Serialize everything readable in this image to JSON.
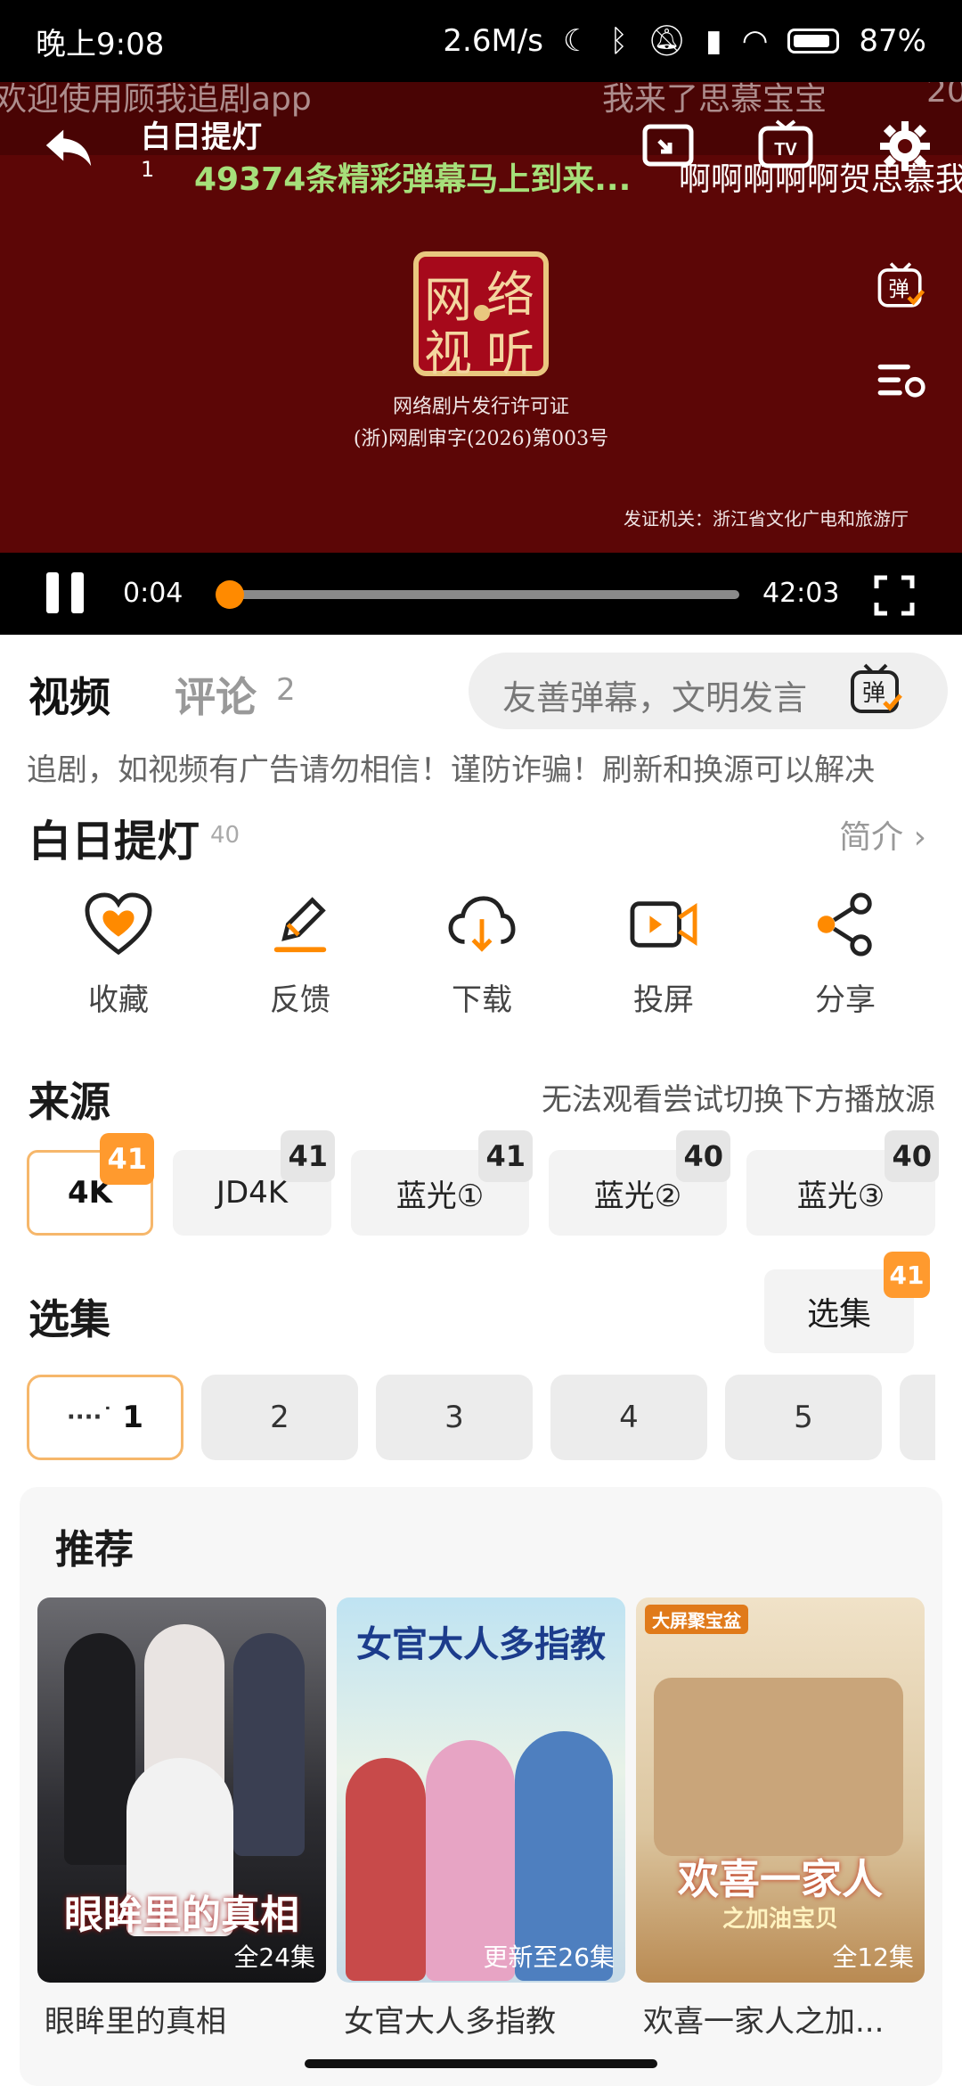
{
  "status_bar": {
    "time": "晚上9:08",
    "speed": "2.6M/s",
    "battery": "87%"
  },
  "player": {
    "title": "白日提灯",
    "episode": "1",
    "danmu": [
      "欢迎使用顾我追剧app",
      "我来了思慕宝宝",
      "20",
      "49374条精彩弹幕马上到来...",
      "啊啊啊啊啊贺思慕我"
    ],
    "seal_chars": [
      "网",
      "络",
      "视",
      "听"
    ],
    "license_line1": "网络剧片发行许可证",
    "license_line2": "(浙)网剧审字(2026)第003号",
    "issuer": "发证机关：浙江省文化广电和旅游厅",
    "time_current": "0:04",
    "time_total": "42:03",
    "progress_fraction": 0.02,
    "tv_label": "TV",
    "danmu_toggle_label": "弹"
  },
  "tabs": {
    "video_label": "视频",
    "comment_label": "评论",
    "comment_count": "2",
    "danmu_placeholder": "友善弹幕，文明发言",
    "danmu_btn_label": "弹"
  },
  "notice": "追剧，如视频有广告请勿相信！谨防诈骗！刷新和换源可以解决",
  "show": {
    "title": "白日提灯",
    "count": "40",
    "intro_label": "简介 ›"
  },
  "actions": [
    {
      "label": "收藏",
      "icon": "heart-icon"
    },
    {
      "label": "反馈",
      "icon": "edit-icon"
    },
    {
      "label": "下载",
      "icon": "cloud-download-icon"
    },
    {
      "label": "投屏",
      "icon": "cast-icon"
    },
    {
      "label": "分享",
      "icon": "share-icon"
    }
  ],
  "source": {
    "title": "来源",
    "hint": "无法观看尝试切换下方播放源",
    "items": [
      {
        "label": "4K",
        "count": "41"
      },
      {
        "label": "JD4K",
        "count": "41"
      },
      {
        "label": "蓝光①",
        "count": "41"
      },
      {
        "label": "蓝光②",
        "count": "40"
      },
      {
        "label": "蓝光③",
        "count": "40"
      }
    ]
  },
  "episodes": {
    "title": "选集",
    "select_label": "选集",
    "select_count": "41",
    "items": [
      "1",
      "2",
      "3",
      "4",
      "5"
    ]
  },
  "recommend": {
    "title": "推荐",
    "items": [
      {
        "name": "眼眸里的真相",
        "badge": "全24集",
        "poster_text": "眼眸里的真相"
      },
      {
        "name": "女官大人多指教",
        "badge": "更新至26集",
        "poster_text": "女官大人多指教"
      },
      {
        "name": "欢喜一家人之加...",
        "badge": "全12集",
        "poster_text": "欢喜一家人",
        "poster_sub": "之加油宝贝",
        "poster_tag": "大屏聚宝盆"
      }
    ]
  },
  "colors": {
    "accent": "#ff8a00",
    "player_bg": "#5c0606",
    "danmu_green": "#a6e07a",
    "active_border": "#f6b76b"
  }
}
